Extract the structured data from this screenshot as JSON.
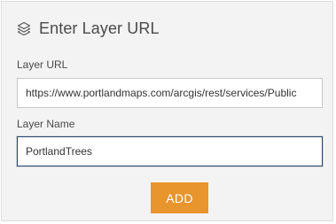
{
  "dialog": {
    "title": "Enter Layer URL",
    "icon": "layers-icon"
  },
  "layer_url": {
    "label": "Layer URL",
    "value": "https://www.portlandmaps.com/arcgis/rest/services/Public"
  },
  "layer_name": {
    "label": "Layer Name",
    "value": "PortlandTrees"
  },
  "actions": {
    "add_label": "ADD"
  },
  "colors": {
    "panel_background": "#f3f3f3",
    "add_button": "#e8952d",
    "focused_border": "#29456e"
  }
}
